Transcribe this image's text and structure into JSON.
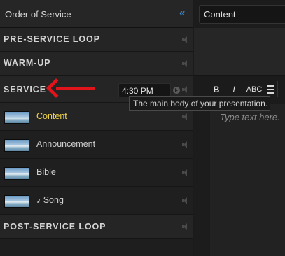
{
  "sidebar": {
    "title": "Order of Service",
    "collapse_glyph": "«",
    "sections": {
      "pre_service": "PRE-SERVICE LOOP",
      "warm_up": "WARM-UP",
      "service": "SERVICE",
      "post_service": "POST-SERVICE LOOP"
    },
    "service_time": "4:30 PM",
    "items": [
      {
        "label": "Content",
        "active": true
      },
      {
        "label": "Announcement",
        "active": false
      },
      {
        "label": "Bible",
        "active": false
      },
      {
        "label": "♪ Song",
        "active": false
      }
    ]
  },
  "tooltip": {
    "text": "The main body of your presentation."
  },
  "editor": {
    "title_value": "Content",
    "toolbar": {
      "bold": "B",
      "italic": "I",
      "spell": "ABC"
    },
    "placeholder": "Type text here."
  },
  "colors": {
    "accent_blue": "#3c7fbf",
    "active_item": "#f0d24a",
    "annotation_arrow": "#e0141a"
  },
  "icons": {
    "collapse": "double-chevron-left-icon",
    "audio": "speaker-icon",
    "clock": "play-clock-icon",
    "slide": "slide-thumbnail-icon"
  }
}
